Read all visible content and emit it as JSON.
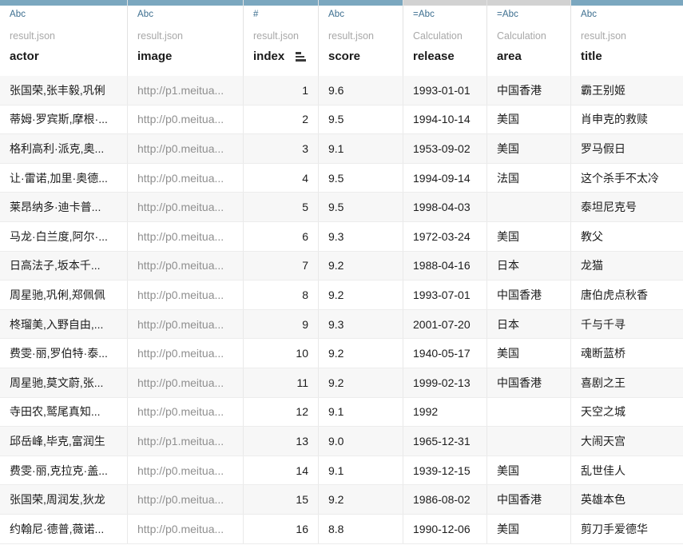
{
  "columns": [
    {
      "type_icon": "Abc",
      "type_name": "abc-text-icon",
      "source": "result.json",
      "name": "actor",
      "bar": "blue",
      "sort_icon": false,
      "align": "left"
    },
    {
      "type_icon": "Abc",
      "type_name": "abc-text-icon",
      "source": "result.json",
      "name": "image",
      "bar": "blue",
      "sort_icon": false,
      "align": "left"
    },
    {
      "type_icon": "#",
      "type_name": "hash-number-icon",
      "source": "result.json",
      "name": "index",
      "bar": "blue",
      "sort_icon": true,
      "align": "right"
    },
    {
      "type_icon": "Abc",
      "type_name": "abc-text-icon",
      "source": "result.json",
      "name": "score",
      "bar": "blue",
      "sort_icon": false,
      "align": "left"
    },
    {
      "type_icon": "=Abc",
      "type_name": "calculated-text-icon",
      "source": "Calculation",
      "name": "release",
      "bar": "gray",
      "sort_icon": false,
      "align": "left"
    },
    {
      "type_icon": "=Abc",
      "type_name": "calculated-text-icon",
      "source": "Calculation",
      "name": "area",
      "bar": "gray",
      "sort_icon": false,
      "align": "left"
    },
    {
      "type_icon": "Abc",
      "type_name": "abc-text-icon",
      "source": "result.json",
      "name": "title",
      "bar": "blue",
      "sort_icon": false,
      "align": "left"
    }
  ],
  "rows": [
    {
      "actor": "张国荣,张丰毅,巩俐",
      "image": "http://p1.meitua...",
      "index": "1",
      "score": "9.6",
      "release": "1993-01-01",
      "area": "中国香港",
      "title": "霸王别姬"
    },
    {
      "actor": "蒂姆·罗宾斯,摩根·...",
      "image": "http://p0.meitua...",
      "index": "2",
      "score": "9.5",
      "release": "1994-10-14",
      "area": "美国",
      "title": "肖申克的救赎"
    },
    {
      "actor": "格利高利·派克,奥...",
      "image": "http://p0.meitua...",
      "index": "3",
      "score": "9.1",
      "release": "1953-09-02",
      "area": "美国",
      "title": "罗马假日"
    },
    {
      "actor": "让·雷诺,加里·奥德...",
      "image": "http://p0.meitua...",
      "index": "4",
      "score": "9.5",
      "release": "1994-09-14",
      "area": "法国",
      "title": "这个杀手不太冷"
    },
    {
      "actor": "莱昂纳多·迪卡普...",
      "image": "http://p0.meitua...",
      "index": "5",
      "score": "9.5",
      "release": "1998-04-03",
      "area": "",
      "title": "泰坦尼克号"
    },
    {
      "actor": "马龙·白兰度,阿尔·...",
      "image": "http://p0.meitua...",
      "index": "6",
      "score": "9.3",
      "release": "1972-03-24",
      "area": "美国",
      "title": "教父"
    },
    {
      "actor": "日高法子,坂本千...",
      "image": "http://p0.meitua...",
      "index": "7",
      "score": "9.2",
      "release": "1988-04-16",
      "area": "日本",
      "title": "龙猫"
    },
    {
      "actor": "周星驰,巩俐,郑佩佩",
      "image": "http://p0.meitua...",
      "index": "8",
      "score": "9.2",
      "release": "1993-07-01",
      "area": "中国香港",
      "title": "唐伯虎点秋香"
    },
    {
      "actor": "柊瑠美,入野自由,...",
      "image": "http://p0.meitua...",
      "index": "9",
      "score": "9.3",
      "release": "2001-07-20",
      "area": "日本",
      "title": "千与千寻"
    },
    {
      "actor": "费雯·丽,罗伯特·泰...",
      "image": "http://p0.meitua...",
      "index": "10",
      "score": "9.2",
      "release": "1940-05-17",
      "area": "美国",
      "title": "魂断蓝桥"
    },
    {
      "actor": "周星驰,莫文蔚,张...",
      "image": "http://p0.meitua...",
      "index": "11",
      "score": "9.2",
      "release": "1999-02-13",
      "area": "中国香港",
      "title": "喜剧之王"
    },
    {
      "actor": "寺田农,鹫尾真知...",
      "image": "http://p0.meitua...",
      "index": "12",
      "score": "9.1",
      "release": "1992",
      "area": "",
      "title": "天空之城"
    },
    {
      "actor": "邱岳峰,毕克,富润生",
      "image": "http://p1.meitua...",
      "index": "13",
      "score": "9.0",
      "release": "1965-12-31",
      "area": "",
      "title": "大闹天宫"
    },
    {
      "actor": "费雯·丽,克拉克·盖...",
      "image": "http://p0.meitua...",
      "index": "14",
      "score": "9.1",
      "release": "1939-12-15",
      "area": "美国",
      "title": "乱世佳人"
    },
    {
      "actor": "张国荣,周润发,狄龙",
      "image": "http://p0.meitua...",
      "index": "15",
      "score": "9.2",
      "release": "1986-08-02",
      "area": "中国香港",
      "title": "英雄本色"
    },
    {
      "actor": "约翰尼·德普,薇诺...",
      "image": "http://p0.meitua...",
      "index": "16",
      "score": "8.8",
      "release": "1990-12-06",
      "area": "美国",
      "title": "剪刀手爱德华"
    }
  ],
  "colors": {
    "header_bar_active": "#7ba7bf",
    "header_bar_inactive": "#d2d2d2",
    "type_label": "#3c6e8f",
    "source_label": "#a8a8a8",
    "row_stripe": "#f7f7f7",
    "url_text": "#8f8f8f"
  }
}
